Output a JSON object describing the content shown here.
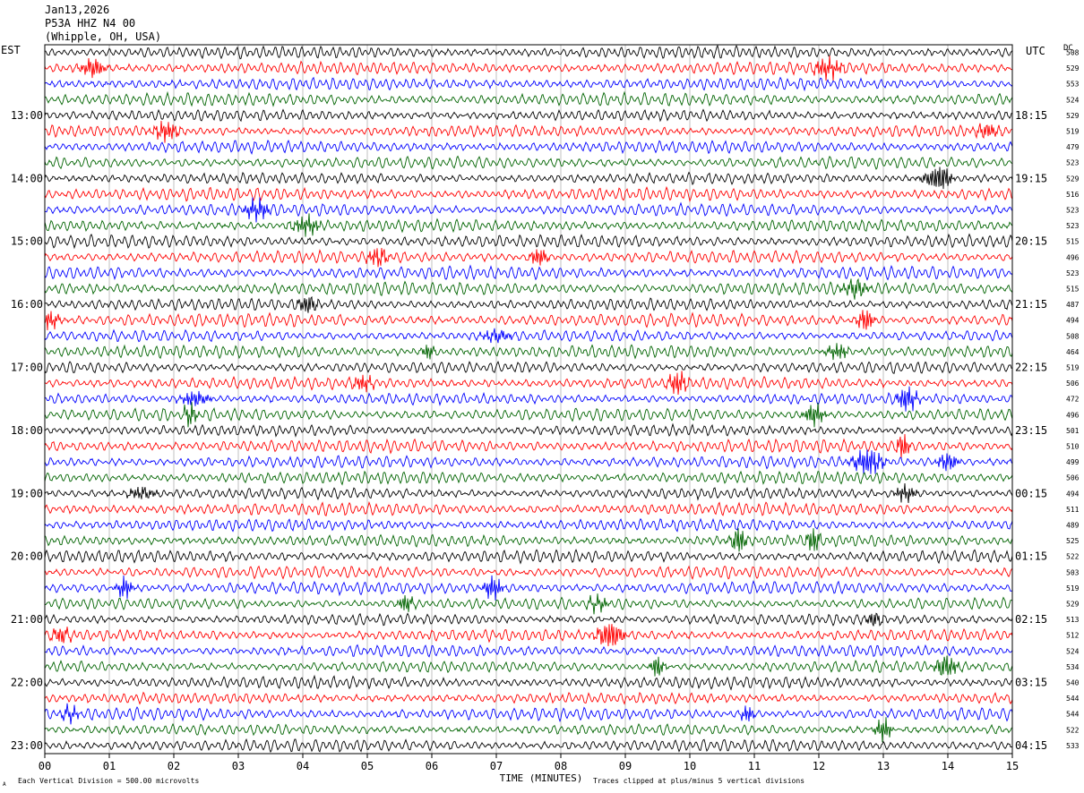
{
  "header": {
    "date": "Jan13,2026",
    "station": "P53A HHZ N4 00",
    "location": "(Whipple, OH, USA)"
  },
  "left_timezone": "EST",
  "right_timezone": "UTC",
  "dc_label": "DC",
  "footer": {
    "scale_note": "Each Vertical Division =  500.00 microvolts",
    "clip_note": "Traces clipped at plus/minus 5 vertical divisions",
    "corner_mark": "A"
  },
  "chart_data": {
    "type": "line",
    "title": "",
    "xlabel": "TIME (MINUTES)",
    "x_ticks": [
      "00",
      "01",
      "02",
      "03",
      "04",
      "05",
      "06",
      "07",
      "08",
      "09",
      "10",
      "11",
      "12",
      "13",
      "14",
      "15"
    ],
    "xlim": [
      0,
      15
    ],
    "trace_colors": [
      "#000000",
      "#ff0000",
      "#0000ff",
      "#006400"
    ],
    "left_hour_labels": [
      "13:00",
      "14:00",
      "15:00",
      "16:00",
      "17:00",
      "18:00",
      "19:00",
      "20:00",
      "21:00",
      "22:00",
      "23:00"
    ],
    "right_hour_labels": [
      "18:15",
      "19:15",
      "20:15",
      "21:15",
      "22:15",
      "23:15",
      "00:15",
      "01:15",
      "02:15",
      "03:15",
      "04:15"
    ],
    "dc_offsets": [
      508,
      529,
      553,
      524,
      529,
      519,
      479,
      523,
      529,
      516,
      523,
      523,
      515,
      496,
      523,
      515,
      487,
      494,
      508,
      464,
      519,
      506,
      472,
      496,
      501,
      510,
      499,
      506,
      494,
      511,
      489,
      525,
      522,
      503,
      519,
      529,
      513,
      512,
      524,
      534,
      540,
      544,
      544,
      522,
      533
    ]
  }
}
